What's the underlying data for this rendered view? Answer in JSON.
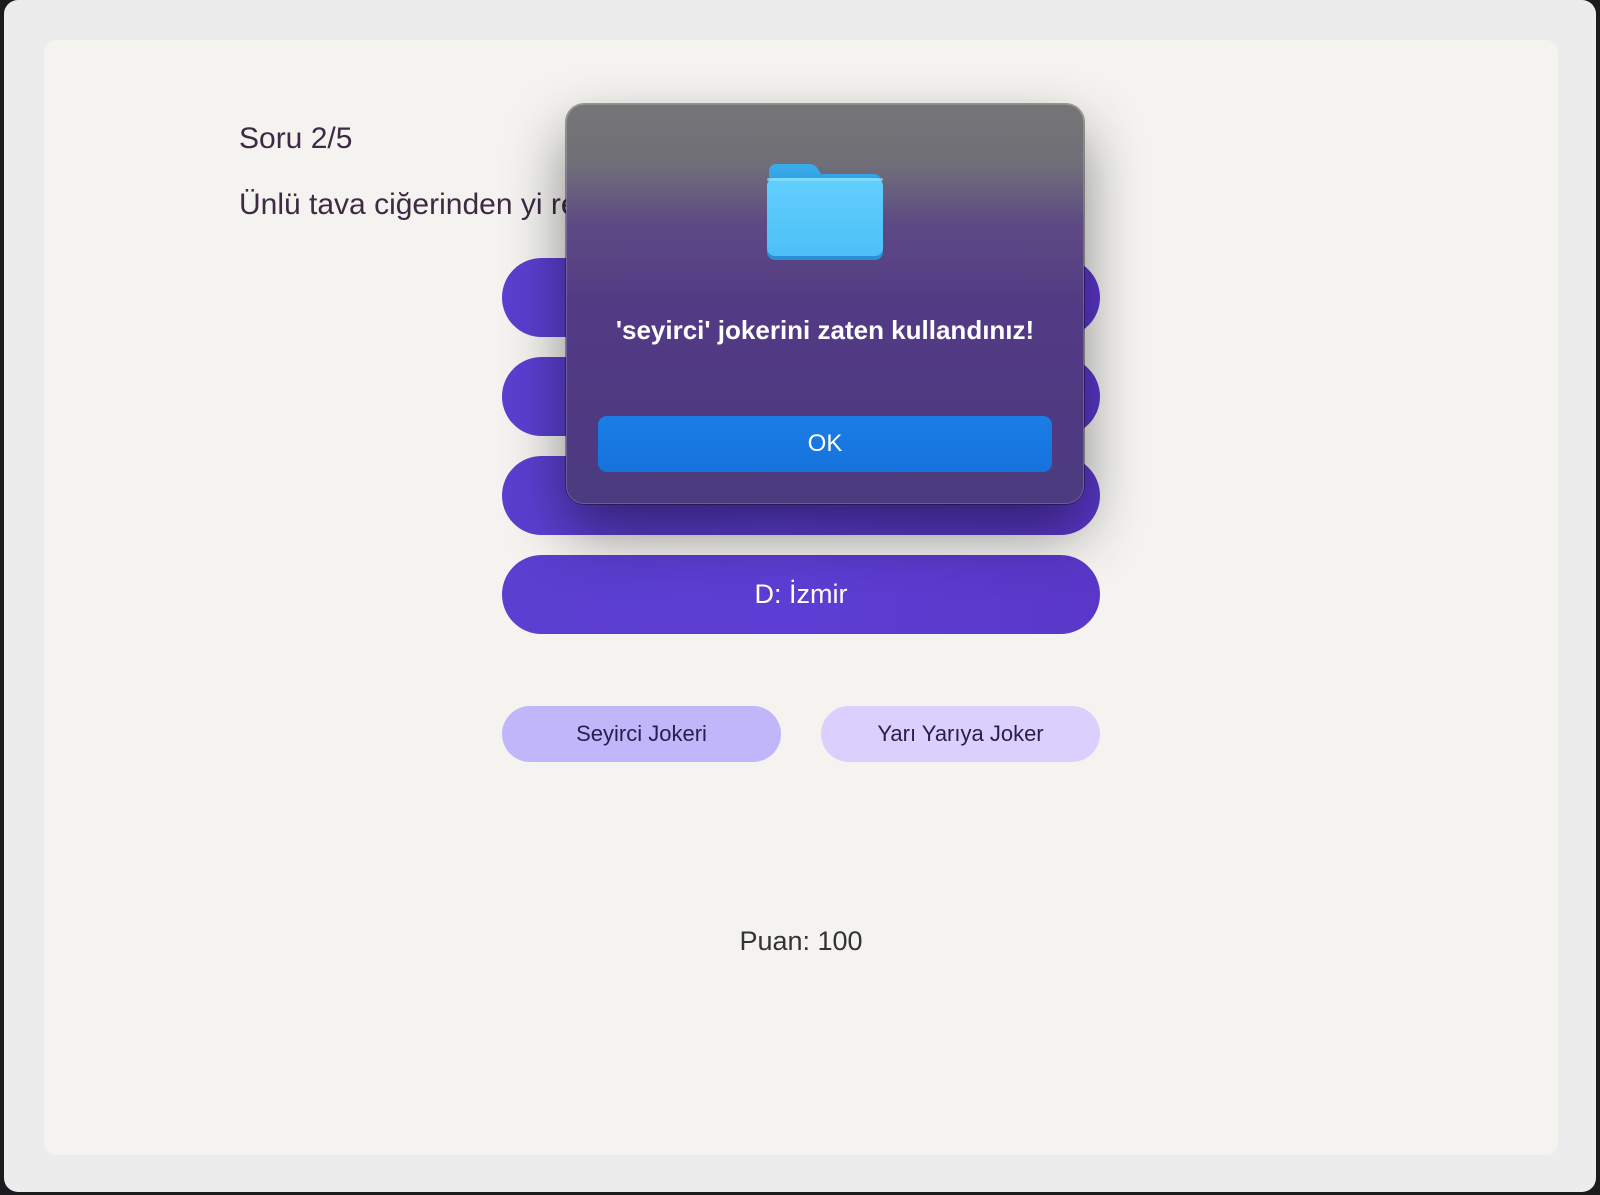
{
  "quiz": {
    "counter": "Soru 2/5",
    "question": "Ünlü tava ciğerinden yi                                              redesiniz demektir?",
    "options": [
      {
        "label": ""
      },
      {
        "label": ""
      },
      {
        "label": ""
      },
      {
        "label": "D: İzmir"
      }
    ],
    "jokers": {
      "audience_label": "Seyirci Jokeri",
      "half_label": "Yarı Yarıya Joker"
    },
    "score": "Puan: 100"
  },
  "dialog": {
    "icon": "folder-icon",
    "message": "'seyirci' jokerini zaten kullandınız!",
    "ok_label": "OK"
  },
  "colors": {
    "option_bg": "#5d3ed4",
    "joker_audience_bg": "#c2b6fb",
    "joker_half_bg": "#d9d0fd",
    "ok_button": "#1672dd",
    "text_primary": "#3d2a45"
  }
}
